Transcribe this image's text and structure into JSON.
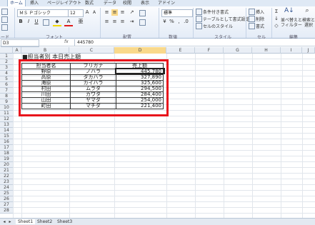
{
  "ribbon_tabs": [
    "ホーム",
    "挿入",
    "ページレイアウト",
    "数式",
    "データ",
    "校閲",
    "表示",
    "アドイン"
  ],
  "ribbon": {
    "font_name": "ＭＳ Ｐゴシック",
    "font_size": "12",
    "number_format": "標準",
    "styles": [
      "条件付き書式",
      "テーブルとして書式設定",
      "セルのスタイル"
    ],
    "cells": [
      "挿入",
      "削除",
      "書式"
    ],
    "edit_sort": "並べ替えと",
    "edit_filter": "フィルター",
    "edit_find": "検索と",
    "edit_select": "選択",
    "groups": [
      "ード",
      "フォント",
      "配置",
      "数値",
      "スタイル",
      "セル",
      "編集"
    ]
  },
  "formula_bar": {
    "name_box": "D3",
    "fx": "fx",
    "value": "445780"
  },
  "columns": [
    "A",
    "B",
    "C",
    "D",
    "E",
    "F",
    "G",
    "H",
    "I",
    "J"
  ],
  "rows": [
    "1",
    "2",
    "3",
    "4",
    "5",
    "6",
    "7",
    "8",
    "9",
    "10",
    "11",
    "12",
    "13",
    "14",
    "15",
    "16",
    "17",
    "18",
    "19",
    "20",
    "21",
    "22",
    "23",
    "24",
    "25",
    "26",
    "27",
    "28",
    "29"
  ],
  "title": "■担当者別 本日売上額",
  "table": {
    "headers": [
      "担当者名",
      "フリガナ",
      "売上額"
    ],
    "rows": [
      [
        "野原",
        "ノハラ",
        "445,780"
      ],
      [
        "高原",
        "タカハラ",
        "327,890"
      ],
      [
        "海原",
        "カイハラ",
        "325,600"
      ],
      [
        "村田",
        "ムラタ",
        "294,500"
      ],
      [
        "川田",
        "カワタ",
        "284,400"
      ],
      [
        "山田",
        "ヤマダ",
        "254,000"
      ],
      [
        "町田",
        "マチダ",
        "221,400"
      ]
    ]
  },
  "sheet_tabs": [
    "Sheet1",
    "Sheet2",
    "Sheet3"
  ],
  "colors": {
    "highlight": "#e8141c",
    "header_bg": "#e9eef5",
    "selected_col": "#f9d98b"
  }
}
